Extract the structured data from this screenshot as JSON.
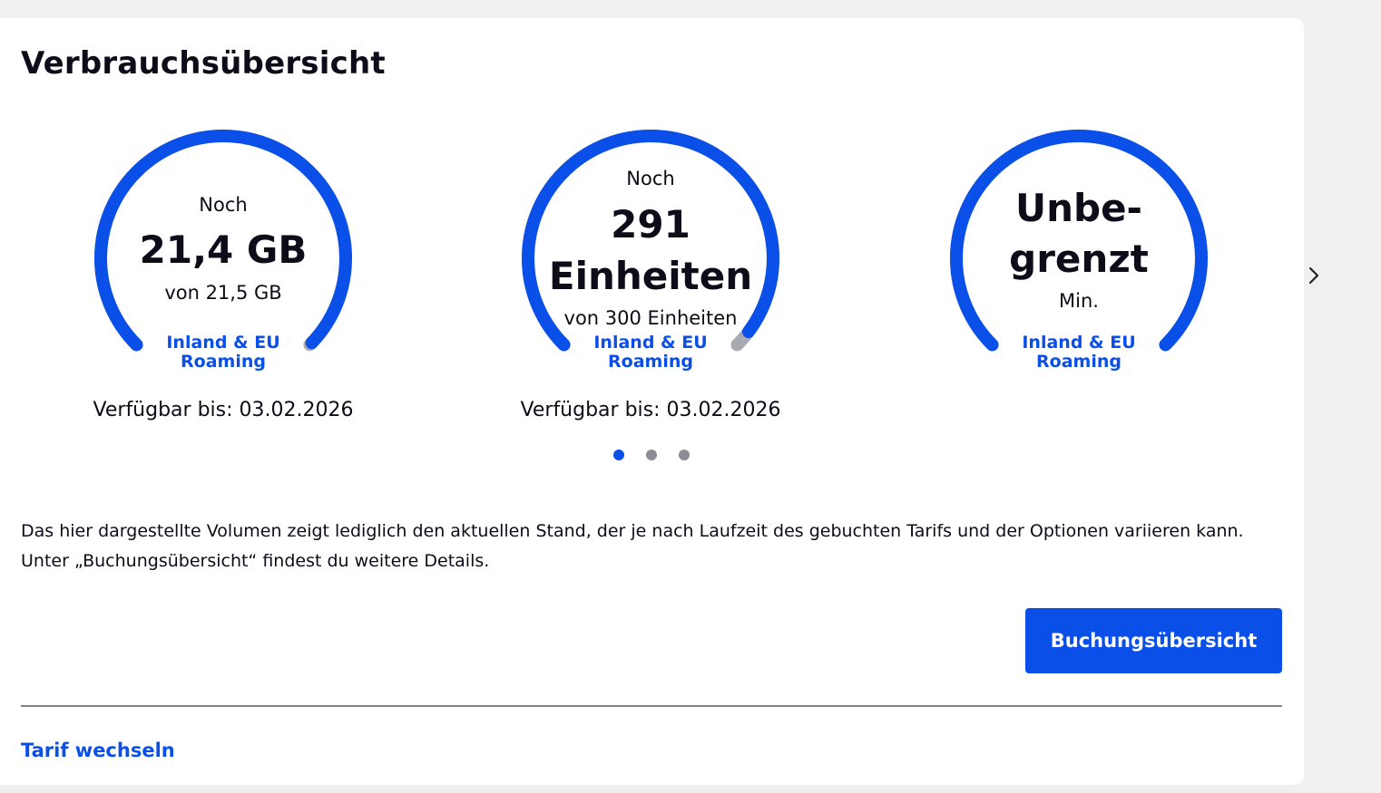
{
  "page": {
    "title": "Verbrauchsübersicht",
    "accent_color": "#0a4fe8",
    "track_color": "#a9a9b0"
  },
  "gauges": [
    {
      "prefix": "Noch",
      "value": "21,4 GB",
      "total": "von 21,5 GB",
      "scope_line1": "Inland & EU",
      "scope_line2": "Roaming",
      "valid_until": "Verfügbar bis: 03.02.2026",
      "remaining_fraction": 0.995
    },
    {
      "prefix": "Noch",
      "value_line1": "291",
      "value_line2": "Einheiten",
      "total": "von 300 Einheiten",
      "scope_line1": "Inland & EU",
      "scope_line2": "Roaming",
      "valid_until": "Verfügbar bis: 03.02.2026",
      "remaining_fraction": 0.97
    },
    {
      "value_line1": "Unbe-",
      "value_line2": "grenzt",
      "unit": "Min.",
      "scope_line1": "Inland & EU",
      "scope_line2": "Roaming",
      "remaining_fraction": 1.0
    }
  ],
  "carousel": {
    "active_index": 0,
    "count": 3,
    "next_icon": "chevron-right-icon"
  },
  "note": "Das hier dargestellte Volumen zeigt lediglich den aktuellen Stand, der je nach Laufzeit des gebuchten Tarifs und der Optionen variieren kann. Unter „Buchungsübersicht“ findest du weitere Details.",
  "actions": {
    "booking_button": "Buchungsübersicht",
    "change_tariff_link": "Tarif wechseln"
  }
}
